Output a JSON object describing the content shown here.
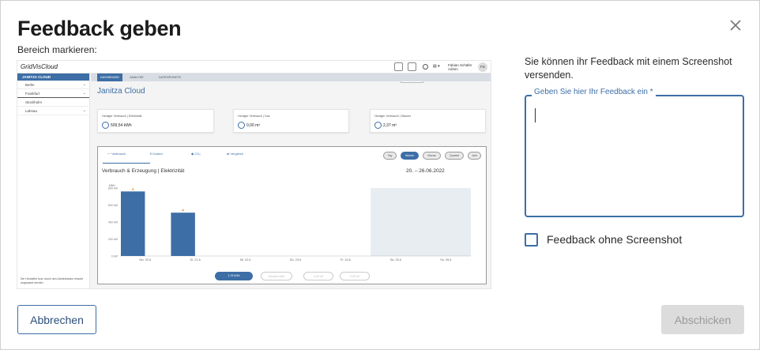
{
  "dialog": {
    "title": "Feedback geben",
    "subtitle": "Bereich markieren:",
    "info_text": "Sie können ihr Feedback mit einem Screenshot versenden.",
    "feedback_label": "Geben Sie hier Ihr Feedback ein *",
    "feedback_value": "",
    "checkbox_label": "Feedback ohne Screenshot",
    "checkbox_checked": false,
    "cancel_label": "Abbrechen",
    "submit_label": "Abschicken",
    "accent_color": "#3d6ea6"
  },
  "preview": {
    "logo_main": "GridVis",
    "logo_sub": "Cloud",
    "user_name": "Fabian Schäfer",
    "user_role": "Admin",
    "user_initials": "FS",
    "tooltip": "Feedback geben",
    "sidebar": {
      "header": "JANITZA CLOUD",
      "items": [
        {
          "label": "Berlin",
          "chevron": true
        },
        {
          "label": "Frankfurt",
          "chevron": true
        },
        {
          "label": "Stockholm",
          "chevron": false
        },
        {
          "label": "Lahnau",
          "chevron": true
        }
      ],
      "footer": "Die Hersteller bzw. durch den Administrator erlaubt angepasst werden"
    },
    "tabs": [
      "DASHBOARD",
      "ANALYSE",
      "DATENPUNKTE"
    ],
    "app_title": "Janitza Cloud",
    "cards": [
      {
        "label": "Heutiger Verbrauch | Elektrizität",
        "value": "509,54 kWh"
      },
      {
        "label": "Heutiger Verbrauch | Gas",
        "value": "0,00 m³"
      },
      {
        "label": "Heutiger Verbrauch | Wasser",
        "value": "2,37 m³"
      }
    ],
    "chart_tabs": [
      "Verbrauch",
      "Kosten",
      "CO₂",
      "Vergleich"
    ],
    "period_pills": [
      "Tag",
      "Woche",
      "Monat",
      "Quartal",
      "Jahr"
    ],
    "active_pill": "Woche",
    "chart_title": "Verbrauch & Erzeugung | Elektrizität",
    "date_range": "20. – 26.06.2022",
    "legend": [
      "1,78 kWh",
      "Gesamt kWh",
      "0,00 m³",
      "0,00 m³"
    ]
  },
  "chart_data": {
    "type": "bar",
    "title": "Verbrauch & Erzeugung | Elektrizität",
    "ylabel": "kWh",
    "categories": [
      "Mo. 20.6",
      "Di. 21.6",
      "Mi. 22.6",
      "Do. 23.6",
      "Fr. 24.6",
      "Sa. 25.6",
      "So. 26.6"
    ],
    "values": [
      760,
      510,
      0,
      0,
      0,
      0,
      0
    ],
    "yticks": [
      "0 kW",
      "200 kW",
      "400 kW",
      "600 kW",
      "800 kW"
    ],
    "ylim": [
      0,
      800
    ],
    "bar_color": "#3d6ea6",
    "highlight_region": [
      "Sa. 25.6",
      "So. 26.6"
    ]
  }
}
